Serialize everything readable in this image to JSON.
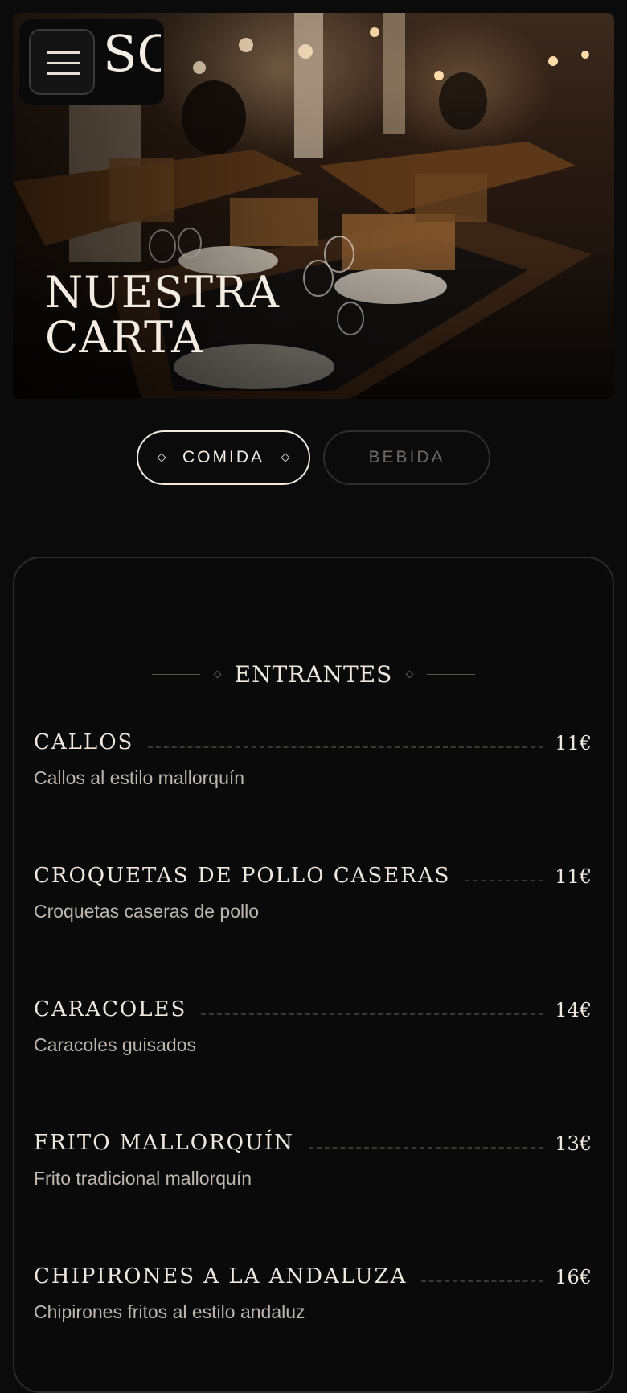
{
  "header": {
    "menu_icon": "hamburger-menu-icon",
    "logo_text": "SC"
  },
  "hero": {
    "title_line1": "NUESTRA",
    "title_line2": "CARTA"
  },
  "tabs": [
    {
      "label": "COMIDA",
      "active": true
    },
    {
      "label": "BEBIDA",
      "active": false
    }
  ],
  "section": {
    "title": "ENTRANTES"
  },
  "items": [
    {
      "name": "CALLOS",
      "price": "11€",
      "description": "Callos al estilo mallorquín"
    },
    {
      "name": "CROQUETAS DE POLLO CASERAS",
      "price": "11€",
      "description": "Croquetas caseras de pollo"
    },
    {
      "name": "CARACOLES",
      "price": "14€",
      "description": "Caracoles guisados"
    },
    {
      "name": "FRITO MALLORQUÍN",
      "price": "13€",
      "description": "Frito tradicional mallorquín"
    },
    {
      "name": "CHIPIRONES A LA ANDALUZA",
      "price": "16€",
      "description": "Chipirones fritos al estilo andaluz"
    }
  ],
  "colors": {
    "background": "#0b0b0b",
    "text": "#efe8de",
    "muted": "#bdb7af",
    "border": "#2c2c2c"
  }
}
